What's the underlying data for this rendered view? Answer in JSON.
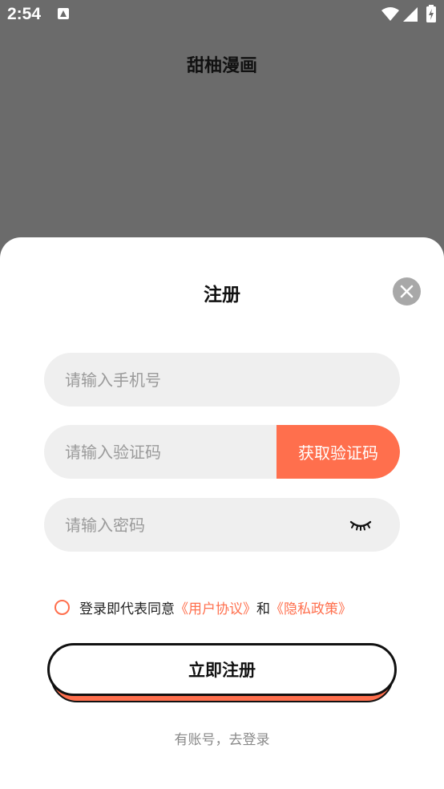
{
  "status_bar": {
    "time": "2:54",
    "icons": [
      "notification-icon",
      "wifi-icon",
      "signal-icon",
      "battery-charging-icon"
    ]
  },
  "app": {
    "title": "甜柚漫画"
  },
  "register_sheet": {
    "title": "注册",
    "close_icon": "close-icon",
    "phone_placeholder": "请输入手机号",
    "code_placeholder": "请输入验证码",
    "get_code_label": "获取验证码",
    "password_placeholder": "请输入密码",
    "password_toggle_icon": "eye-closed-icon",
    "agreement": {
      "prefix": "登录即代表同意",
      "user_agreement": "《用户协议》",
      "joiner": "和",
      "privacy_policy": "《隐私政策》",
      "checked": false
    },
    "register_label": "立即注册",
    "login_link": "有账号，去登录"
  },
  "colors": {
    "accent": "#ff6f4d",
    "backdrop": "#6b6b6b",
    "field_bg": "#efefef",
    "close_bg": "#a8a8a8"
  }
}
